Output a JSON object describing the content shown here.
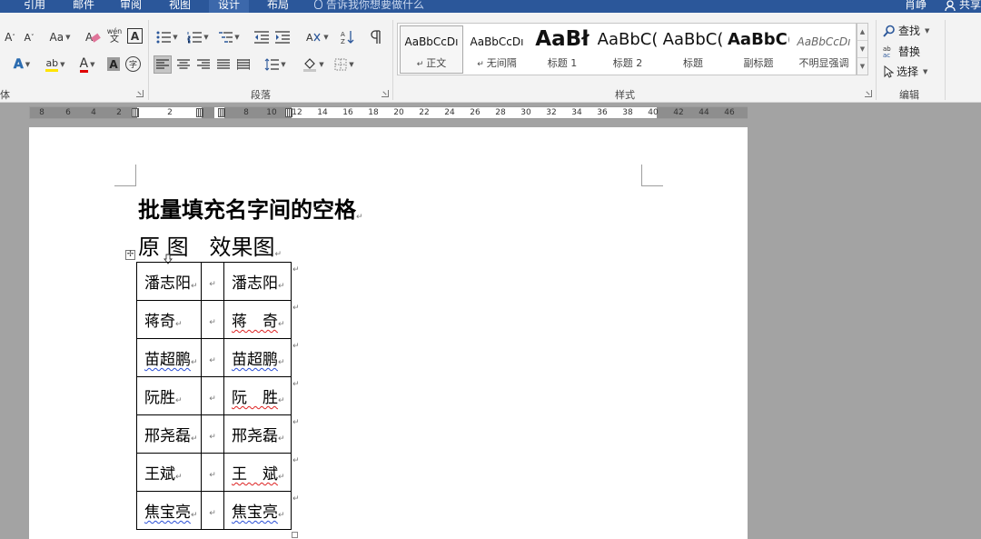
{
  "ribbon_tabs": [
    "引用",
    "邮件",
    "审阅",
    "视图",
    "设计",
    "布局"
  ],
  "active_tab": "设计",
  "tell_me": "告诉我你想要做什么",
  "user_name": "肖峥",
  "share_label": "共享",
  "groups": {
    "font": "体",
    "paragraph": "段落",
    "styles": "样式",
    "editing": "编辑"
  },
  "font_tools": {
    "grow": "A",
    "shrink": "A",
    "case": "Aa",
    "phonetic_top": "wén",
    "phonetic_bottom": "文",
    "border_char": "A",
    "effects": "A",
    "highlight": "ab",
    "color": "A",
    "shade": "A",
    "enclose": "字"
  },
  "styles": [
    {
      "preview": "AaBbCcDı",
      "name": "正文"
    },
    {
      "preview": "AaBbCcDı",
      "name": "无间隔"
    },
    {
      "preview": "AaBł",
      "name": "标题 1"
    },
    {
      "preview": "AaBbC(",
      "name": "标题 2"
    },
    {
      "preview": "AaBbC(",
      "name": "标题"
    },
    {
      "preview": "AaBbC(",
      "name": "副标题"
    },
    {
      "preview": "AaBbCcDı",
      "name": "不明显强调"
    }
  ],
  "editing": {
    "find": "查找",
    "replace": "替换",
    "select": "选择"
  },
  "ruler": {
    "left_numbers": [
      "8",
      "6",
      "4",
      "2"
    ],
    "indent_numbers": [
      "2"
    ],
    "cell_numbers": [
      "8",
      "10"
    ],
    "right_numbers": [
      "12",
      "14",
      "16",
      "18",
      "20",
      "22",
      "24",
      "26",
      "28",
      "30",
      "32",
      "34",
      "36",
      "38",
      "40",
      "42",
      "44",
      "46"
    ]
  },
  "document": {
    "title": "批量填充名字间的空格",
    "subtitle": "原 图   效果图",
    "rows": [
      {
        "original": "潘志阳",
        "result": "潘志阳"
      },
      {
        "original": "蒋奇",
        "result": "蒋　奇"
      },
      {
        "original": "苗超鹏",
        "result": "苗超鹏"
      },
      {
        "original": "阮胜",
        "result": "阮　胜"
      },
      {
        "original": "邢尧磊",
        "result": "邢尧磊"
      },
      {
        "original": "王斌",
        "result": "王　斌"
      },
      {
        "original": "焦宝亮",
        "result": "焦宝亮"
      }
    ]
  }
}
